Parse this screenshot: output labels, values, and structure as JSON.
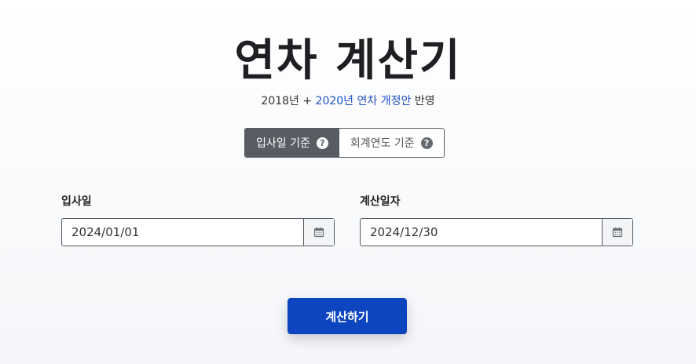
{
  "page": {
    "title": "연차 계산기",
    "subtitle_prefix": "2018년 + ",
    "subtitle_link": "2020년 연차 개정안",
    "subtitle_suffix": " 반영"
  },
  "toggle": {
    "options": [
      {
        "label": "입사일 기준",
        "active": true,
        "icon": "question-circle-icon"
      },
      {
        "label": "회계연도 기준",
        "active": false,
        "icon": "question-circle-icon"
      }
    ]
  },
  "fields": {
    "hire_date": {
      "label": "입사일",
      "value": "2024/01/01",
      "icon": "calendar-icon"
    },
    "calc_date": {
      "label": "계산일자",
      "value": "2024/12/30",
      "icon": "calendar-icon"
    }
  },
  "actions": {
    "calculate_label": "계산하기"
  },
  "colors": {
    "primary": "#0d45c1",
    "link": "#1b4fc4",
    "toggle_active": "#585c63"
  }
}
